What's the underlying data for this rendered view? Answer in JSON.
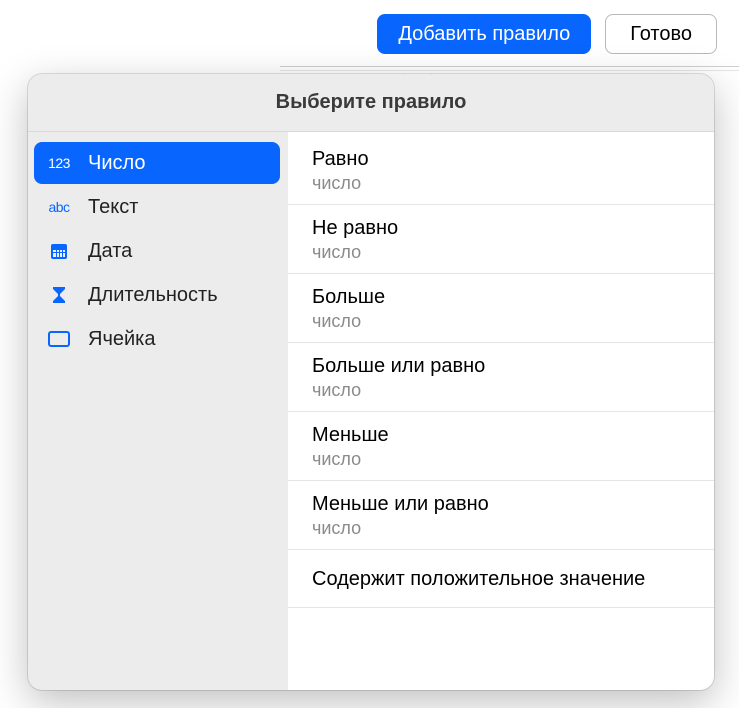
{
  "topbar": {
    "add_rule": "Добавить правило",
    "done": "Готово"
  },
  "popover": {
    "title": "Выберите правило",
    "categories": [
      {
        "icon": "123",
        "label": "Число"
      },
      {
        "icon": "abc",
        "label": "Текст"
      },
      {
        "icon": "calendar",
        "label": "Дата"
      },
      {
        "icon": "hourglass",
        "label": "Длительность"
      },
      {
        "icon": "cell",
        "label": "Ячейка"
      }
    ],
    "rules": [
      {
        "title": "Равно",
        "sub": "число"
      },
      {
        "title": "Не равно",
        "sub": "число"
      },
      {
        "title": "Больше",
        "sub": "число"
      },
      {
        "title": "Больше или равно",
        "sub": "число"
      },
      {
        "title": "Меньше",
        "sub": "число"
      },
      {
        "title": "Меньше или равно",
        "sub": "число"
      },
      {
        "title": "Содержит положительное значение"
      }
    ]
  }
}
